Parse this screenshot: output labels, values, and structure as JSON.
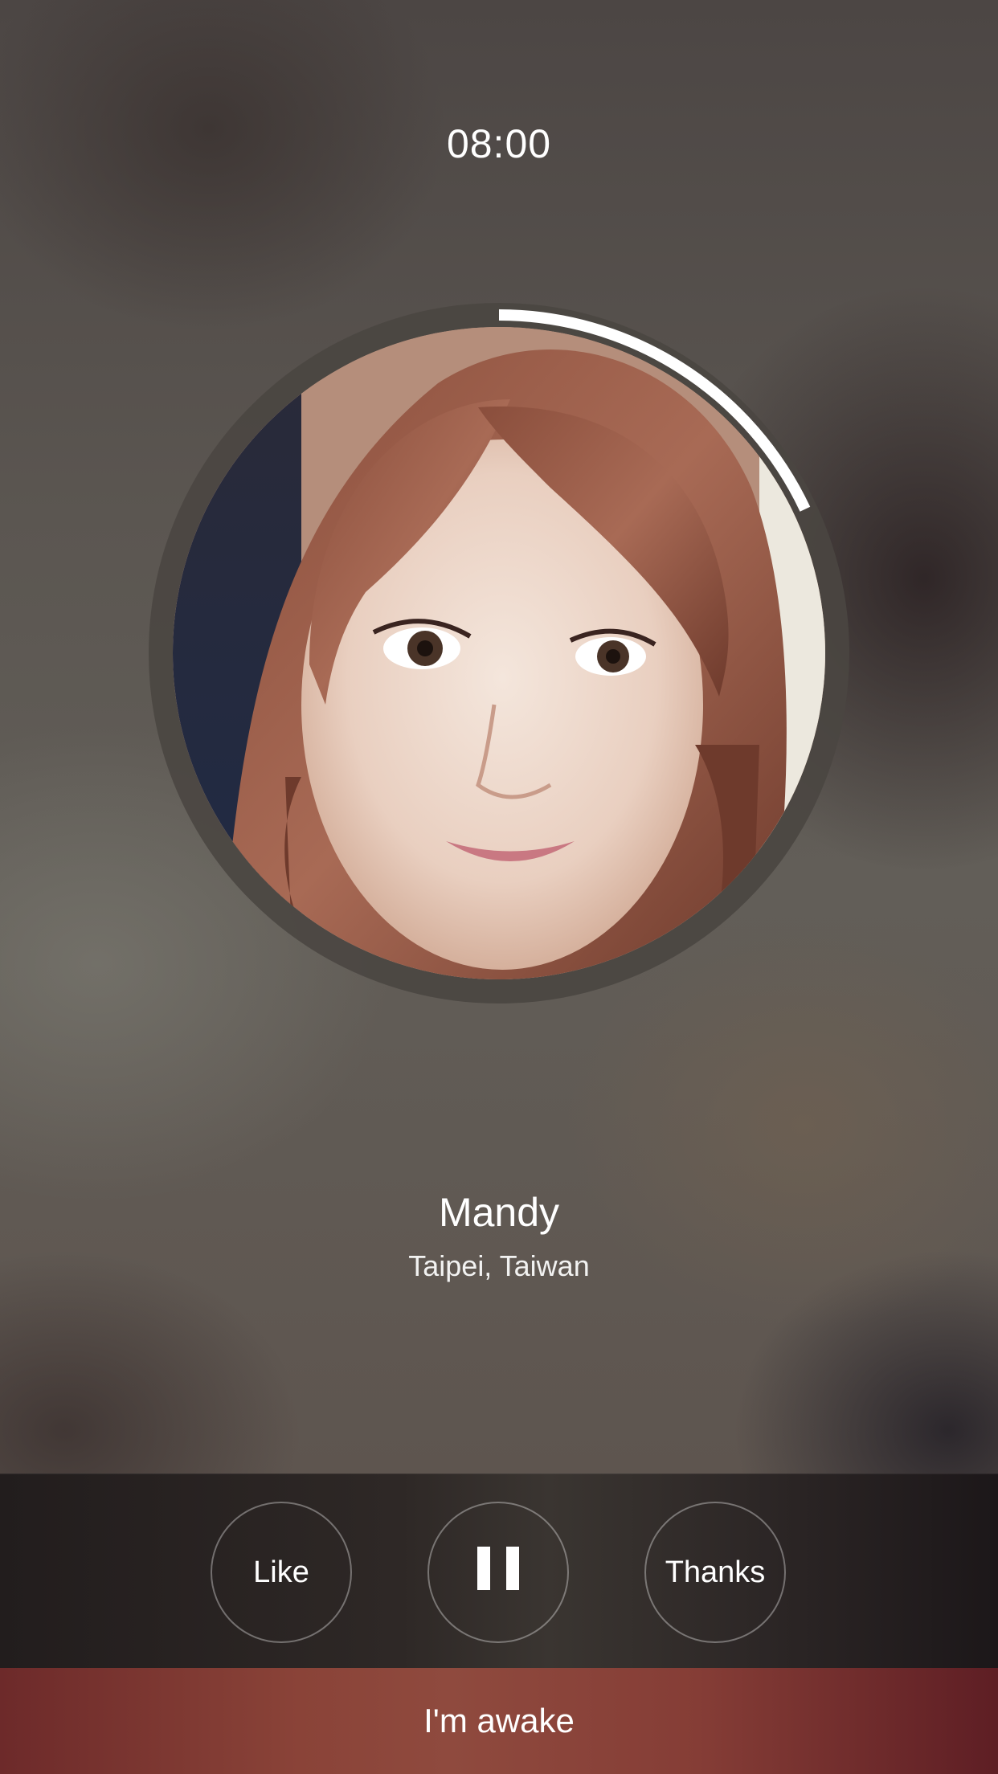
{
  "alarm": {
    "time": "08:00",
    "progress_fraction": 0.18
  },
  "caller": {
    "name": "Mandy",
    "location": "Taipei, Taiwan"
  },
  "controls": {
    "like_label": "Like",
    "pause_icon": "pause-icon",
    "thanks_label": "Thanks"
  },
  "awake_button": {
    "label": "I'm awake"
  },
  "colors": {
    "awake_bar": "#8a4338",
    "progress_arc": "#ffffff",
    "ring_track": "#4a4641"
  }
}
